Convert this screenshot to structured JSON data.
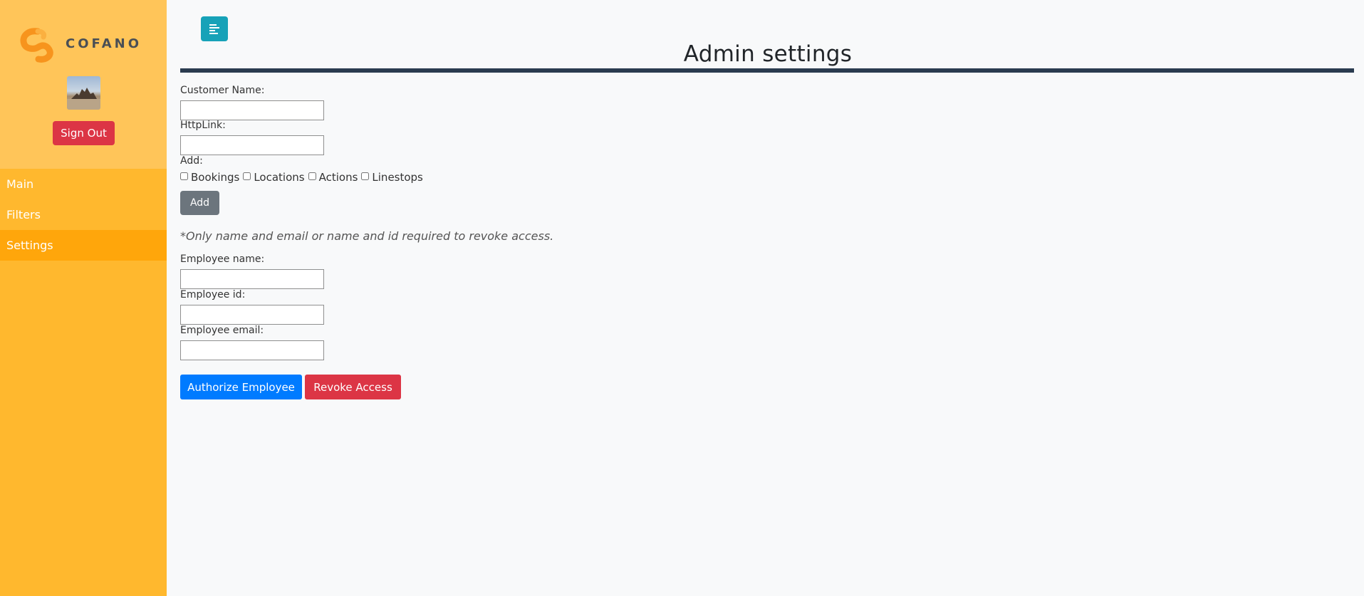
{
  "brand": {
    "name": "COFANO",
    "primary_color": "#ffb82e",
    "active_color": "#ffa60b"
  },
  "sidebar": {
    "sign_out_label": "Sign Out",
    "items": [
      {
        "label": "Main",
        "active": false
      },
      {
        "label": "Filters",
        "active": false
      },
      {
        "label": "Settings",
        "active": true
      }
    ]
  },
  "header": {
    "toggle_icon": "align-left-icon",
    "title": "Admin settings"
  },
  "customer_form": {
    "customer_name_label": "Customer Name:",
    "customer_name_value": "",
    "http_link_label": "HttpLink:",
    "http_link_value": "",
    "add_label": "Add:",
    "options": [
      "Bookings",
      "Locations",
      "Actions",
      "Linestops"
    ],
    "add_button": "Add"
  },
  "employee_form": {
    "note": "*Only name and email or name and id required to revoke access.",
    "name_label": "Employee name:",
    "name_value": "",
    "id_label": "Employee id:",
    "id_value": "",
    "email_label": "Employee email:",
    "email_value": "",
    "authorize_button": "Authorize Employee",
    "revoke_button": "Revoke Access"
  }
}
